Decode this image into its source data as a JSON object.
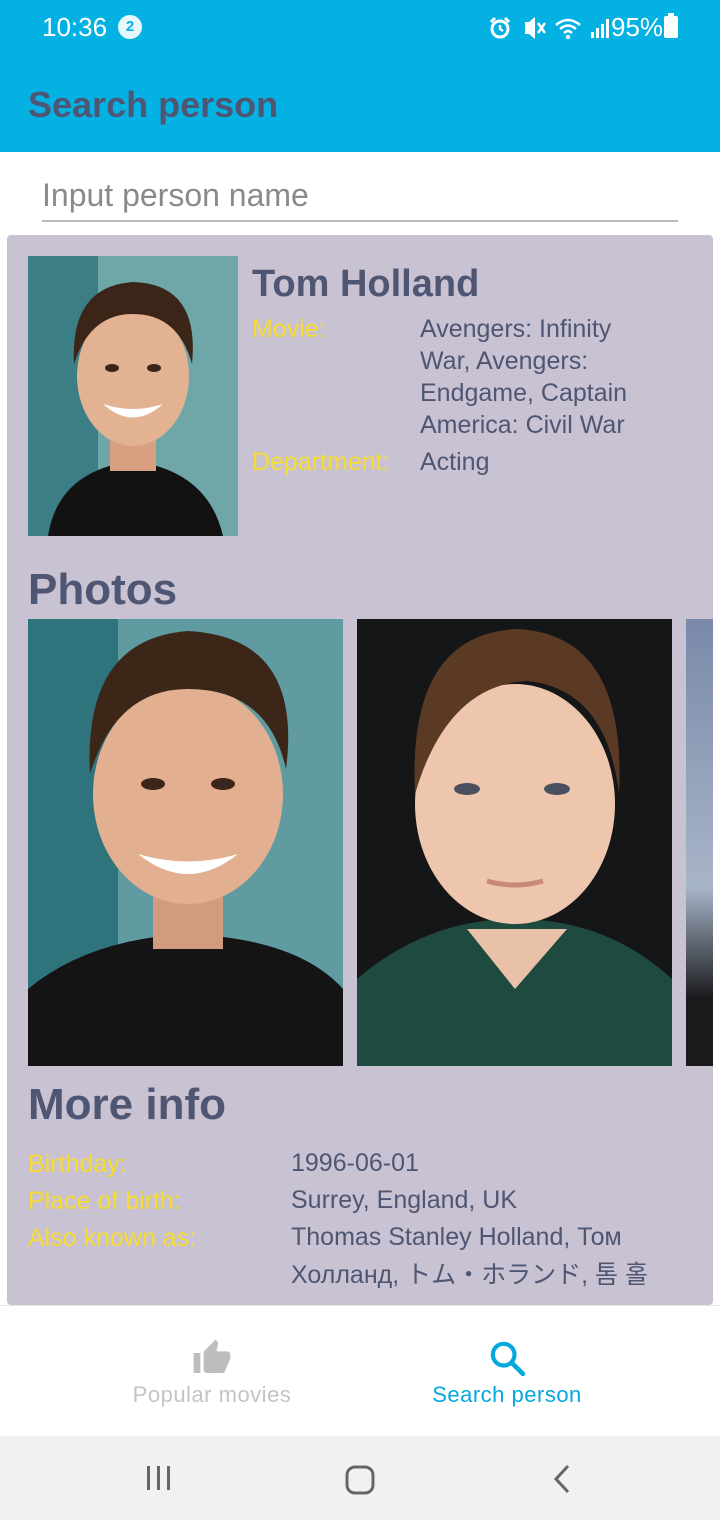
{
  "status_bar": {
    "time": "10:36",
    "notification_count": "2",
    "battery": "95%"
  },
  "app_bar": {
    "title": "Search person"
  },
  "search": {
    "placeholder": "Input person name",
    "value": ""
  },
  "person": {
    "name": "Tom Holland",
    "movie_label": "Movie:",
    "movie_lines": [
      "Avengers: Infinity",
      "War, Avengers:",
      "Endgame, Captain",
      "America: Civil War"
    ],
    "department_label": "Department:",
    "department_value": "Acting"
  },
  "photos": {
    "title": "Photos"
  },
  "more_info": {
    "title": "More info",
    "birthday_label": "Birthday:",
    "birthday_value": "1996-06-01",
    "place_label": "Place of birth:",
    "place_value": "Surrey, England, UK",
    "aka_label": "Also known as:",
    "aka_line1": "Thomas Stanley Holland, Том",
    "aka_line2": "Холланд, トム・ホランド, 톰 홀"
  },
  "bottom_nav": {
    "items": [
      {
        "label": "Popular movies",
        "icon": "thumbs-up-icon",
        "active": false
      },
      {
        "label": "Search person",
        "icon": "search-icon",
        "active": true
      }
    ]
  },
  "colors": {
    "primary": "#03b1e3",
    "title_text": "#4f5673",
    "label_yellow": "#f7dc2f",
    "card_bg": "#c8c2d2",
    "nav_inactive": "#bdbdbd"
  },
  "system_nav": {
    "icons": [
      "recent-apps-icon",
      "home-icon",
      "back-icon"
    ]
  }
}
